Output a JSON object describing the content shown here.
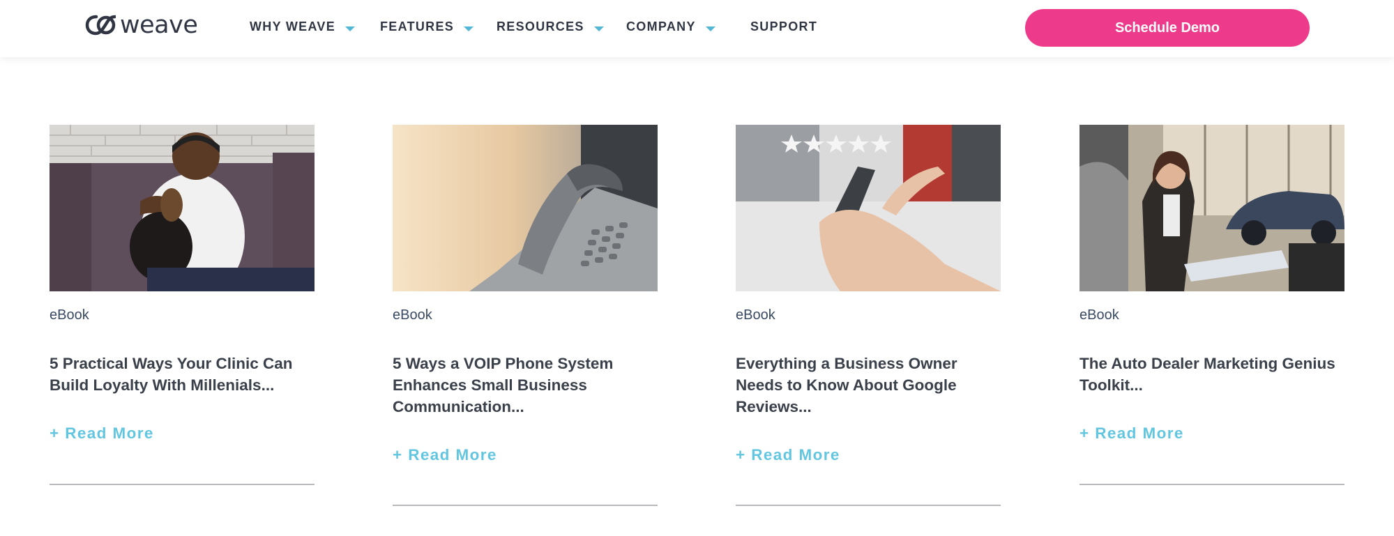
{
  "header": {
    "logo_text": "weave",
    "nav": [
      {
        "label": "WHY WEAVE",
        "dropdown": true
      },
      {
        "label": "FEATURES",
        "dropdown": true
      },
      {
        "label": "RESOURCES",
        "dropdown": true
      },
      {
        "label": "COMPANY",
        "dropdown": true
      },
      {
        "label": "SUPPORT",
        "dropdown": false
      }
    ],
    "cta_label": "Schedule Demo"
  },
  "colors": {
    "brand_pink": "#ee3a8a",
    "accent_blue": "#63c6e0",
    "text_dark": "#2f3542"
  },
  "cards": [
    {
      "type": "eBook",
      "title": "5 Practical Ways Your Clinic Can Build Loyalty With Millenials...",
      "read_more": "+ Read More",
      "image": "man-with-dog-on-couch-photo"
    },
    {
      "type": "eBook",
      "title": "5 Ways a VOIP Phone System Enhances Small Business Communication...",
      "read_more": "+ Read More",
      "image": "office-desk-phone-photo"
    },
    {
      "type": "eBook",
      "title": "Everything a Business Owner Needs to Know About Google Reviews...",
      "read_more": "+ Read More",
      "image": "hands-smartphone-five-stars-photo"
    },
    {
      "type": "eBook",
      "title": "The Auto Dealer Marketing Genius Toolkit...",
      "read_more": "+ Read More",
      "image": "car-dealership-woman-photo"
    }
  ]
}
